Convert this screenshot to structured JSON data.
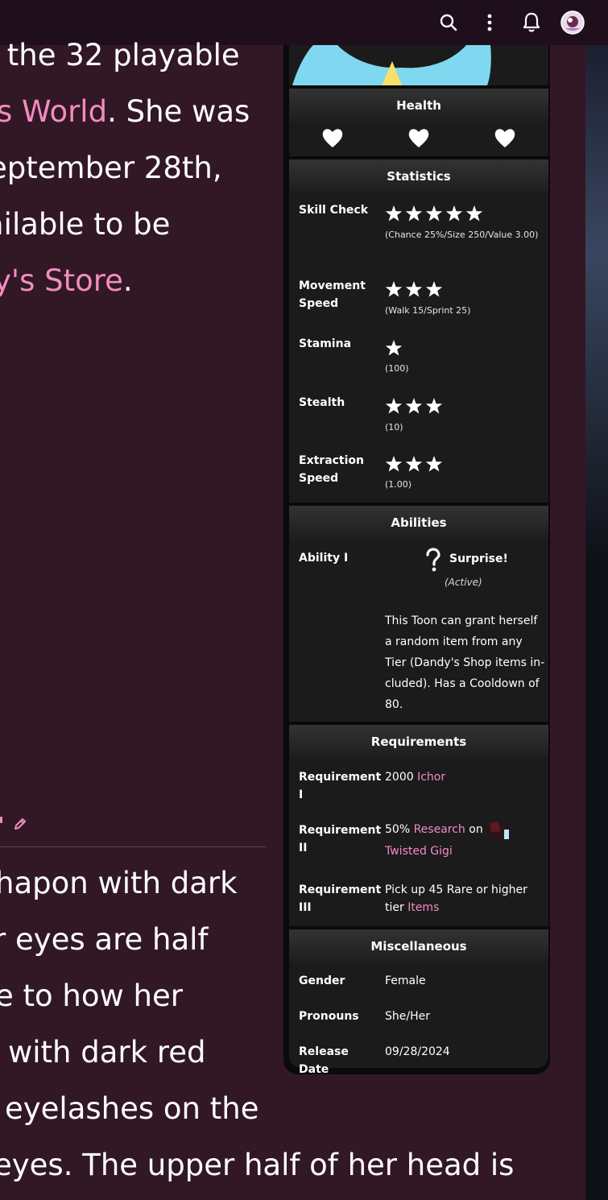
{
  "topbar": {
    "icons": [
      "search-icon",
      "more-vertical-icon",
      "bell-icon",
      "avatar"
    ]
  },
  "article": {
    "para1": {
      "line1": "f the 32 playable",
      "line2_link": "s World",
      "line2_rest": ". She was",
      "line3": "eptember 28th,",
      "line4": "ailable to be",
      "line5_link": "y's Store",
      "line5_rest": "."
    },
    "para2": {
      "line1": "hapon with dark",
      "line2": "r eyes are half",
      "line3": "e to how her",
      "line4": "with dark red",
      "line5": "eyelashes on the",
      "line6": "eyes. The upper half of her head is"
    }
  },
  "infobox": {
    "health": {
      "header": "Health",
      "hearts": 3
    },
    "statistics": {
      "header": "Statistics",
      "rows": [
        {
          "label": "Skill Check",
          "stars": 5,
          "sub": "(Chance 25%/Size 250/Value 3.00)"
        },
        {
          "label": "Movement Speed",
          "stars": 3,
          "sub": "(Walk 15/Sprint 25)"
        },
        {
          "label": "Stamina",
          "stars": 1,
          "sub": "(100)"
        },
        {
          "label": "Stealth",
          "stars": 3,
          "sub": "(10)"
        },
        {
          "label": "Extraction Speed",
          "stars": 3,
          "sub": "(1.00)"
        }
      ]
    },
    "abilities": {
      "header": "Abilities",
      "label": "Ability I",
      "name": "Surprise!",
      "type": "(Active)",
      "description": "This Toon can grant herself a random item from any Tier (Dandy's Shop items in-cluded). Has a Cooldown of 80."
    },
    "requirements": {
      "header": "Requirements",
      "rows": [
        {
          "label": "Requirement I",
          "pre": "2000 ",
          "link": "Ichor",
          "post": ""
        },
        {
          "label": "Requirement II",
          "pre": "50% ",
          "link": "Research",
          "mid": " on",
          "link2": "Twisted Gigi"
        },
        {
          "label": "Requirement III",
          "pre": "Pick up 45 Rare or higher tier ",
          "link": "Items",
          "post": ""
        }
      ]
    },
    "misc": {
      "header": "Miscellaneous",
      "rows": [
        {
          "label": "Gender",
          "value": "Female"
        },
        {
          "label": "Pronouns",
          "value": "She/Her"
        },
        {
          "label": "Release Date",
          "value": "09/28/2024"
        }
      ]
    }
  },
  "colors": {
    "page_bg": "#311824",
    "topbar_bg": "#1f0f1c",
    "link": "#f28cc0",
    "infobox_bg": "#1b1b1b",
    "infobox_border": "#0a0a0a"
  }
}
